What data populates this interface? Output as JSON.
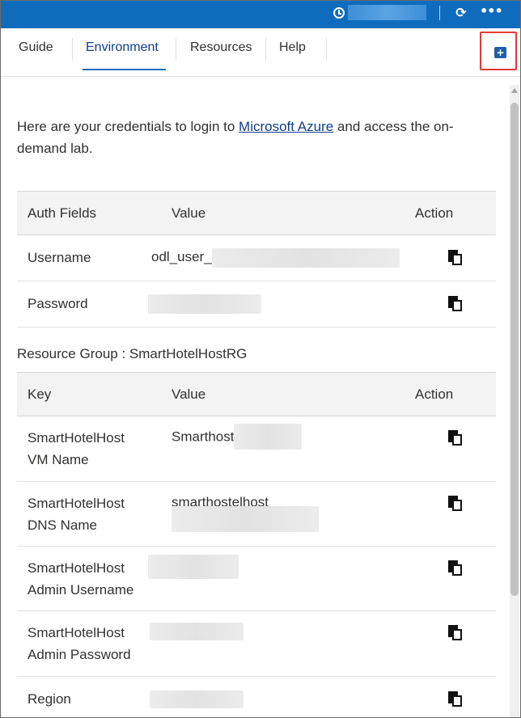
{
  "topbar": {
    "icons": [
      "timer-icon",
      "refresh-icon",
      "more-icon"
    ],
    "refresh_glyph": "⟳",
    "more_glyph": "•••",
    "accent": "#0f6cbd"
  },
  "tabs": [
    {
      "label": "Guide"
    },
    {
      "label": "Environment",
      "active": true
    },
    {
      "label": "Resources"
    },
    {
      "label": "Help"
    }
  ],
  "popout": {
    "icon": "add-window-icon",
    "glyph": "+",
    "highlight": "#e53935"
  },
  "intro": {
    "before": "Here are your credentials to login to ",
    "link": "Microsoft Azure",
    "after": " and access the on-demand lab."
  },
  "auth_table": {
    "headers": [
      "Auth Fields",
      "Value",
      "Action"
    ],
    "rows": [
      {
        "field": "Username",
        "value": "odl_user_"
      },
      {
        "field": "Password",
        "value": ""
      }
    ]
  },
  "resource_group": {
    "label": "Resource Group : SmartHotelHostRG"
  },
  "rg_table": {
    "headers": [
      "Key",
      "Value",
      "Action"
    ],
    "rows": [
      {
        "key_line1": "SmartHotelHost",
        "key_line2": "VM Name",
        "value": "Smarthost"
      },
      {
        "key_line1": "SmartHotelHost",
        "key_line2": "DNS Name",
        "value": "smarthostelhost"
      },
      {
        "key_line1": "SmartHotelHost",
        "key_line2": "Admin Username",
        "value": ""
      },
      {
        "key_line1": "SmartHotelHost",
        "key_line2": "Admin Password",
        "value": ""
      },
      {
        "key_line1": "Region",
        "key_line2": "",
        "value": ""
      }
    ]
  }
}
